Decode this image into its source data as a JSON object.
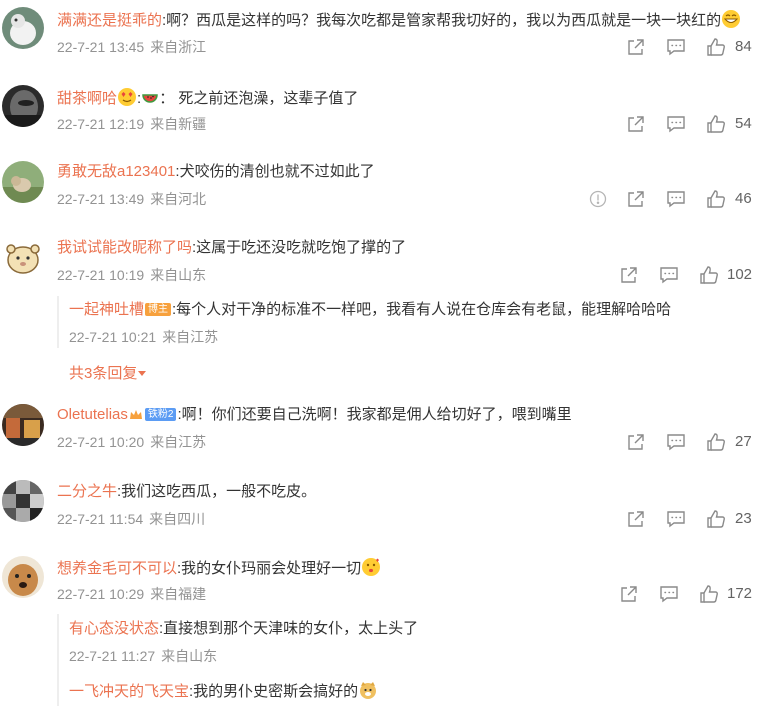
{
  "icons": {
    "share": "share-icon",
    "comment": "comment-icon",
    "like": "like-icon",
    "report": "report-icon",
    "triangle": "triangle-down-icon"
  },
  "colors": {
    "username": "#eb7350",
    "meta": "#939393",
    "icon": "#8a8a8a",
    "badge_author": "#f7a13d",
    "badge_fan": "#5b9cf4"
  },
  "comments": [
    {
      "username": "满满还是挺乖的",
      "text": ":啊？西瓜是这样的吗？我每次吃都是管家帮我切好的，我以为西瓜就是一块一块红的",
      "emoji_after": "grin-emoji",
      "date": "22-7-21 13:45",
      "location": "来自浙江",
      "likes": "84"
    },
    {
      "username": "甜茶啊哈",
      "emoji_after_name": [
        "heart-eyes-emoji",
        "watermelon-emoji"
      ],
      "text": "： 死之前还泡澡，这辈子值了",
      "date": "22-7-21 12:19",
      "location": "来自新疆",
      "likes": "54"
    },
    {
      "username": "勇敢无敌a123401",
      "text": ":犬咬伤的清创也就不过如此了",
      "date": "22-7-21 13:49",
      "location": "来自河北",
      "likes": "46"
    },
    {
      "username": "我试试能改昵称了吗",
      "text": ":这属于吃还没吃就吃饱了撑的了",
      "date": "22-7-21 10:19",
      "location": "来自山东",
      "likes": "102",
      "replies": [
        {
          "username": "一起神吐槽",
          "badge": "博主",
          "text": ":每个人对干净的标准不一样吧，我看有人说在仓库会有老鼠，能理解哈哈哈",
          "date": "22-7-21 10:21",
          "location": "来自江苏"
        }
      ],
      "more_replies": "共3条回复"
    },
    {
      "username": "Oletutelias",
      "badge": "铁粉2",
      "text": ":啊！你们还要自己洗啊！我家都是佣人给切好了，喂到嘴里",
      "date": "22-7-21 10:20",
      "location": "来自江苏",
      "likes": "27"
    },
    {
      "username": "二分之牛",
      "text": ":我们这吃西瓜，一般不吃皮。",
      "date": "22-7-21 11:54",
      "location": "来自四川",
      "likes": "23"
    },
    {
      "username": "想养金毛可不可以",
      "text": ":我的女仆玛丽会处理好一切",
      "emoji_after": "kiss-emoji",
      "date": "22-7-21 10:29",
      "location": "来自福建",
      "likes": "172",
      "replies": [
        {
          "username": "有心态没状态",
          "text": ":直接想到那个天津味的女仆，太上头了",
          "date": "22-7-21 11:27",
          "location": "来自山东"
        },
        {
          "username": "一飞冲天的飞天宝",
          "text": ":我的男仆史密斯会搞好的",
          "emoji_after": "doge-emoji"
        }
      ]
    }
  ]
}
